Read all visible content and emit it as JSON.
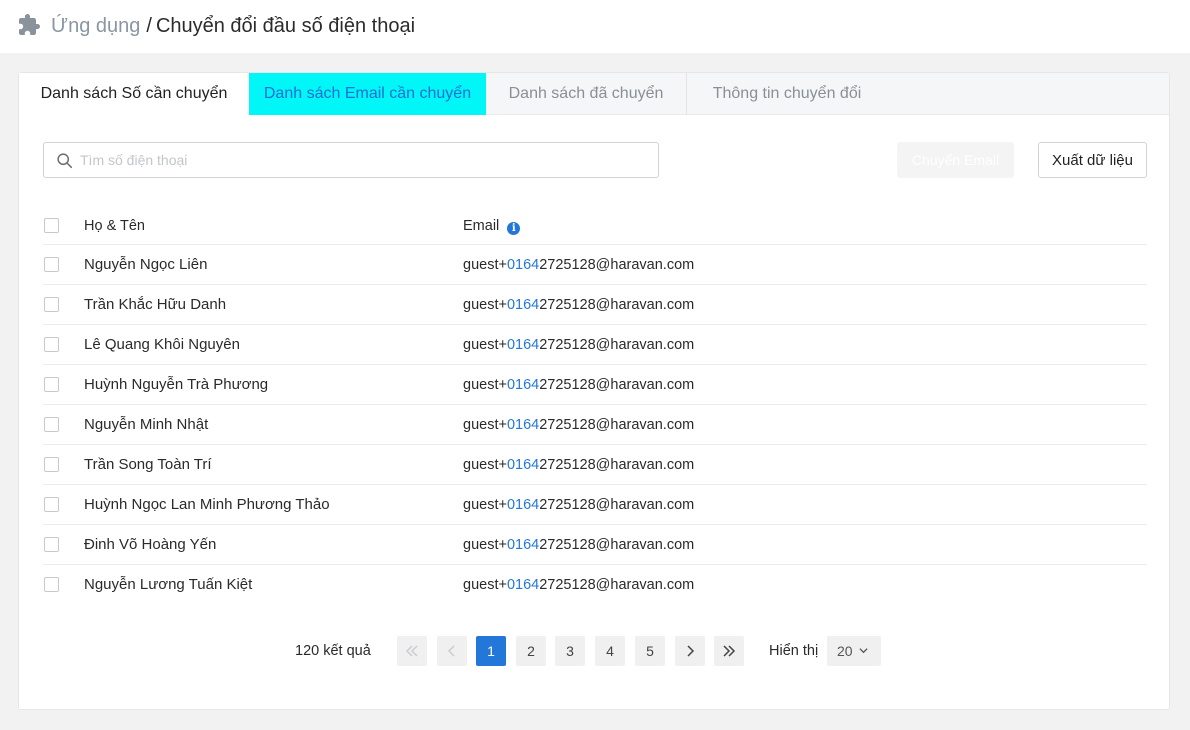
{
  "breadcrumb": {
    "root": "Ứng dụng",
    "separator": "/",
    "current": "Chuyển đổi đầu số điện thoại",
    "icon": "puzzle-icon"
  },
  "tabs": [
    {
      "label": "Danh sách Số cần chuyển",
      "state": "normal"
    },
    {
      "label": "Danh sách Email cần chuyển",
      "state": "active"
    },
    {
      "label": "Danh sách đã chuyển",
      "state": "normal"
    },
    {
      "label": "Thông tin chuyển đổi",
      "state": "normal"
    }
  ],
  "search": {
    "placeholder": "Tìm số điện thoại",
    "value": "",
    "icon": "search-icon"
  },
  "actions": {
    "convert_label": "Chuyển Email",
    "export_label": "Xuất dữ liệu"
  },
  "table": {
    "headers": {
      "name": "Họ & Tên",
      "email": "Email"
    },
    "rows": [
      {
        "name": "Nguyễn Ngọc Liên",
        "email_prefix": "guest+",
        "email_highlight": "0164",
        "email_suffix": "2725128@haravan.com"
      },
      {
        "name": "Trần Khắc Hữu Danh",
        "email_prefix": "guest+",
        "email_highlight": "0164",
        "email_suffix": "2725128@haravan.com"
      },
      {
        "name": "Lê Quang Khôi Nguyên",
        "email_prefix": "guest+",
        "email_highlight": "0164",
        "email_suffix": "2725128@haravan.com"
      },
      {
        "name": "Huỳnh Nguyễn Trà Phương",
        "email_prefix": "guest+",
        "email_highlight": "0164",
        "email_suffix": "2725128@haravan.com"
      },
      {
        "name": "Nguyễn Minh Nhật",
        "email_prefix": "guest+",
        "email_highlight": "0164",
        "email_suffix": "2725128@haravan.com"
      },
      {
        "name": "Trần Song Toàn Trí",
        "email_prefix": "guest+",
        "email_highlight": "0164",
        "email_suffix": "2725128@haravan.com"
      },
      {
        "name": "Huỳnh Ngọc Lan Minh Phương Thảo",
        "email_prefix": "guest+",
        "email_highlight": "0164",
        "email_suffix": "2725128@haravan.com"
      },
      {
        "name": "Đinh Võ Hoàng Yến",
        "email_prefix": "guest+",
        "email_highlight": "0164",
        "email_suffix": "2725128@haravan.com"
      },
      {
        "name": "Nguyễn Lương Tuấn Kiệt",
        "email_prefix": "guest+",
        "email_highlight": "0164",
        "email_suffix": "2725128@haravan.com"
      }
    ]
  },
  "pagination": {
    "total_text": "120 kết quả",
    "pages": [
      "1",
      "2",
      "3",
      "4",
      "5"
    ],
    "current_page": "1",
    "show_label": "Hiển thị",
    "page_size": "20"
  },
  "colors": {
    "accent": "#2277d9",
    "active_tab_bg": "#00f6f7",
    "page_bg": "#f2f2f2"
  }
}
